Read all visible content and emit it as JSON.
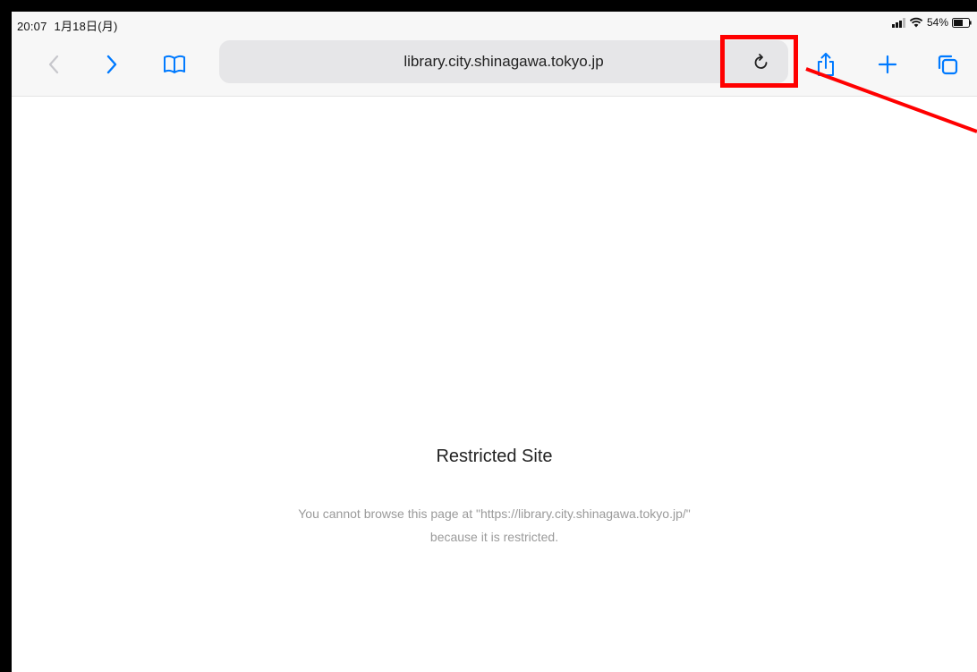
{
  "status_bar": {
    "time": "20:07",
    "date": "1月18日(月)",
    "battery_percent": "54%",
    "icons": [
      "signal-icon",
      "wifi-icon",
      "battery-icon"
    ]
  },
  "toolbar": {
    "icons": [
      "back-icon",
      "forward-icon",
      "bookmarks-icon",
      "reload-icon",
      "share-icon",
      "new-tab-icon",
      "tabs-icon"
    ],
    "url": "library.city.shinagawa.tokyo.jp",
    "accent_color": "#007aff",
    "disabled_color": "#c7c7cc"
  },
  "annotation": {
    "color": "#ff0000"
  },
  "page": {
    "title": "Restricted Site",
    "message_line1": "You cannot browse this page at \"https://library.city.shinagawa.tokyo.jp/\"",
    "message_line2": "because it is restricted."
  }
}
